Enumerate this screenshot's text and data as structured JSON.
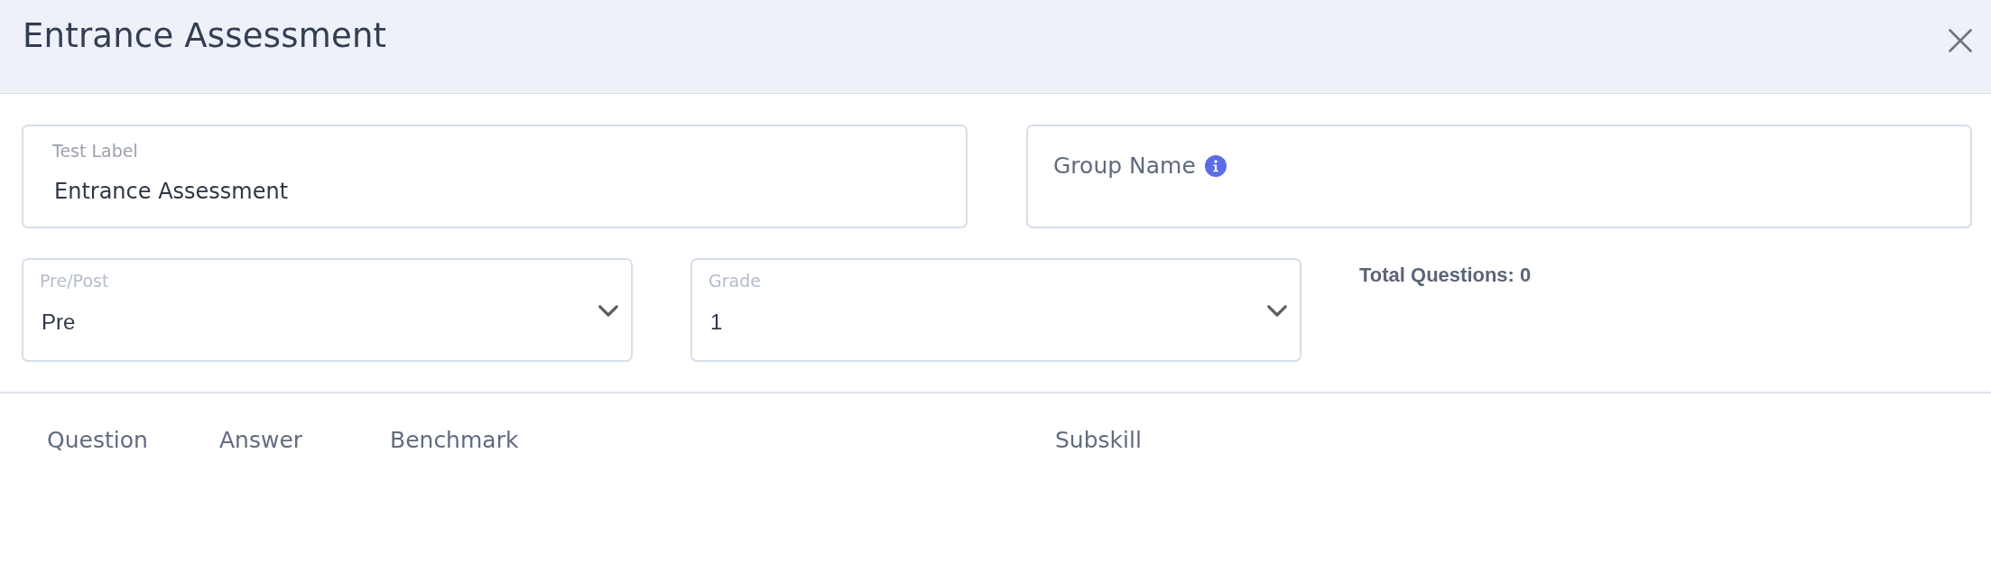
{
  "dialog": {
    "title": "Entrance Assessment"
  },
  "fields": [
    {
      "label": "Test Label",
      "value": "Entrance Assessment",
      "info": false
    },
    {
      "label": "Group Name",
      "info": true
    }
  ],
  "dropdowns": [
    {
      "label": "Pre/Post",
      "value": "Pre"
    },
    {
      "label": "Grade",
      "value": "1"
    }
  ],
  "total_questions": "Total Questions: 0",
  "table": {
    "columns": [
      "Question",
      "Answer",
      "Benchmark",
      "Subskill"
    ]
  }
}
